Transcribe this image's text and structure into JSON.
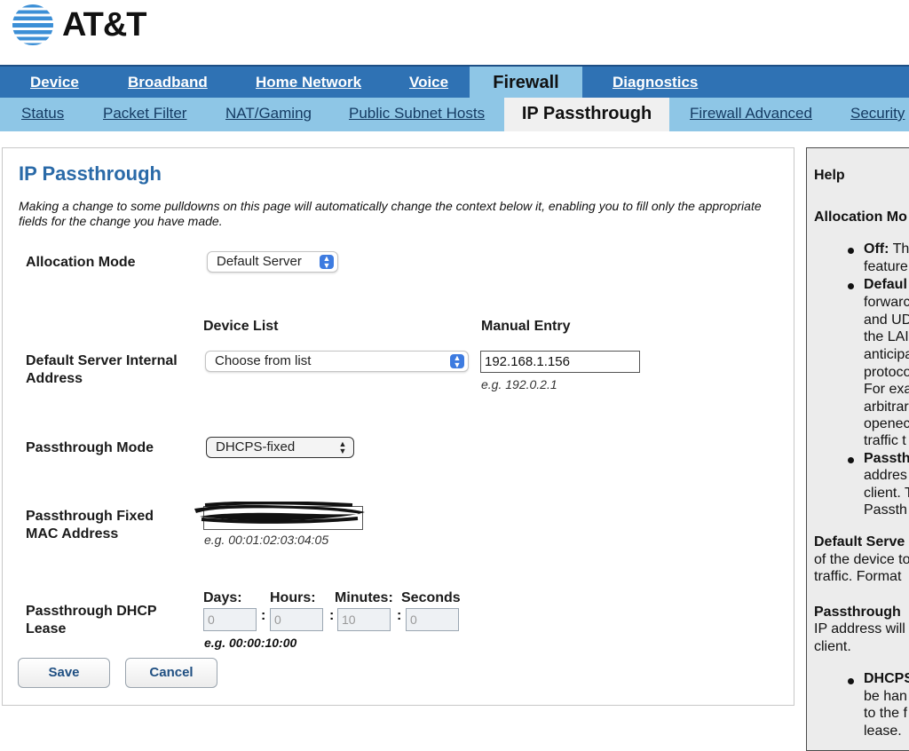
{
  "brand": {
    "logo_text": "AT&T"
  },
  "nav_primary": {
    "items": [
      {
        "label": "Device"
      },
      {
        "label": "Broadband"
      },
      {
        "label": "Home Network"
      },
      {
        "label": "Voice"
      },
      {
        "label": "Firewall",
        "active": true
      },
      {
        "label": "Diagnostics"
      }
    ]
  },
  "nav_secondary": {
    "items": [
      {
        "label": "Status"
      },
      {
        "label": "Packet Filter"
      },
      {
        "label": "NAT/Gaming"
      },
      {
        "label": "Public Subnet Hosts"
      },
      {
        "label": "IP Passthrough",
        "active": true
      },
      {
        "label": "Firewall Advanced"
      },
      {
        "label": "Security "
      }
    ]
  },
  "main": {
    "title": "IP Passthrough",
    "intro": "Making a change to some pulldowns on this page will automatically change the context below it, enabling you to fill only the appropriate fields for the change you have made.",
    "allocation_mode": {
      "label": "Allocation Mode",
      "value": "Default Server"
    },
    "device_list_header": "Device List",
    "manual_entry_header": "Manual Entry",
    "default_server": {
      "label": "Default Server Internal Address",
      "device_list_value": "Choose from list",
      "manual_value": "192.168.1.156",
      "hint": "e.g. 192.0.2.1"
    },
    "passthrough_mode": {
      "label": "Passthrough Mode",
      "value": "DHCPS-fixed"
    },
    "passthrough_mac": {
      "label": "Passthrough Fixed MAC Address",
      "value": "",
      "hint": "e.g. 00:01:02:03:04:05"
    },
    "dhcp_lease": {
      "label": "Passthrough DHCP Lease",
      "headers": {
        "days": "Days:",
        "hours": "Hours:",
        "minutes": "Minutes:",
        "seconds": "Seconds"
      },
      "values": {
        "days": "0",
        "hours": "0",
        "minutes": "10",
        "seconds": "0"
      },
      "hint": "e.g. 00:00:10:00"
    },
    "buttons": {
      "save": "Save",
      "cancel": "Cancel"
    }
  },
  "help": {
    "title": "Help",
    "allocation_heading": "Allocation Mo",
    "bullet_off": {
      "term": "Off:",
      "rest": " Th",
      "line2": "feature"
    },
    "bullet_default": {
      "term": "Defaul",
      "lines": [
        "forwarc",
        "and UD",
        "the LAI",
        "anticipa",
        "protoco",
        "For exa",
        "arbitrar",
        "openec",
        "traffic t"
      ]
    },
    "bullet_passthrough": {
      "term": "Passth",
      "lines": [
        "addres",
        "client. T",
        "Passth"
      ]
    },
    "default_server_heading": "Default Serve",
    "default_server_lines": [
      "of the device to",
      "traffic. Format"
    ],
    "passthrough_heading": "Passthrough",
    "passthrough_lines": [
      "IP address will",
      "client."
    ],
    "bullet_dhcps": {
      "term": "DHCPS",
      "lines": [
        "be han",
        "to the f",
        "lease."
      ]
    }
  },
  "colors": {
    "nav_primary": "#2f72b4",
    "nav_secondary": "#8ec6e6",
    "title": "#2a6aa8",
    "select_accent": "#3d7be0"
  },
  "icons": {
    "logo": "att-globe-icon",
    "select_arrows": "chevron-updown-icon"
  }
}
